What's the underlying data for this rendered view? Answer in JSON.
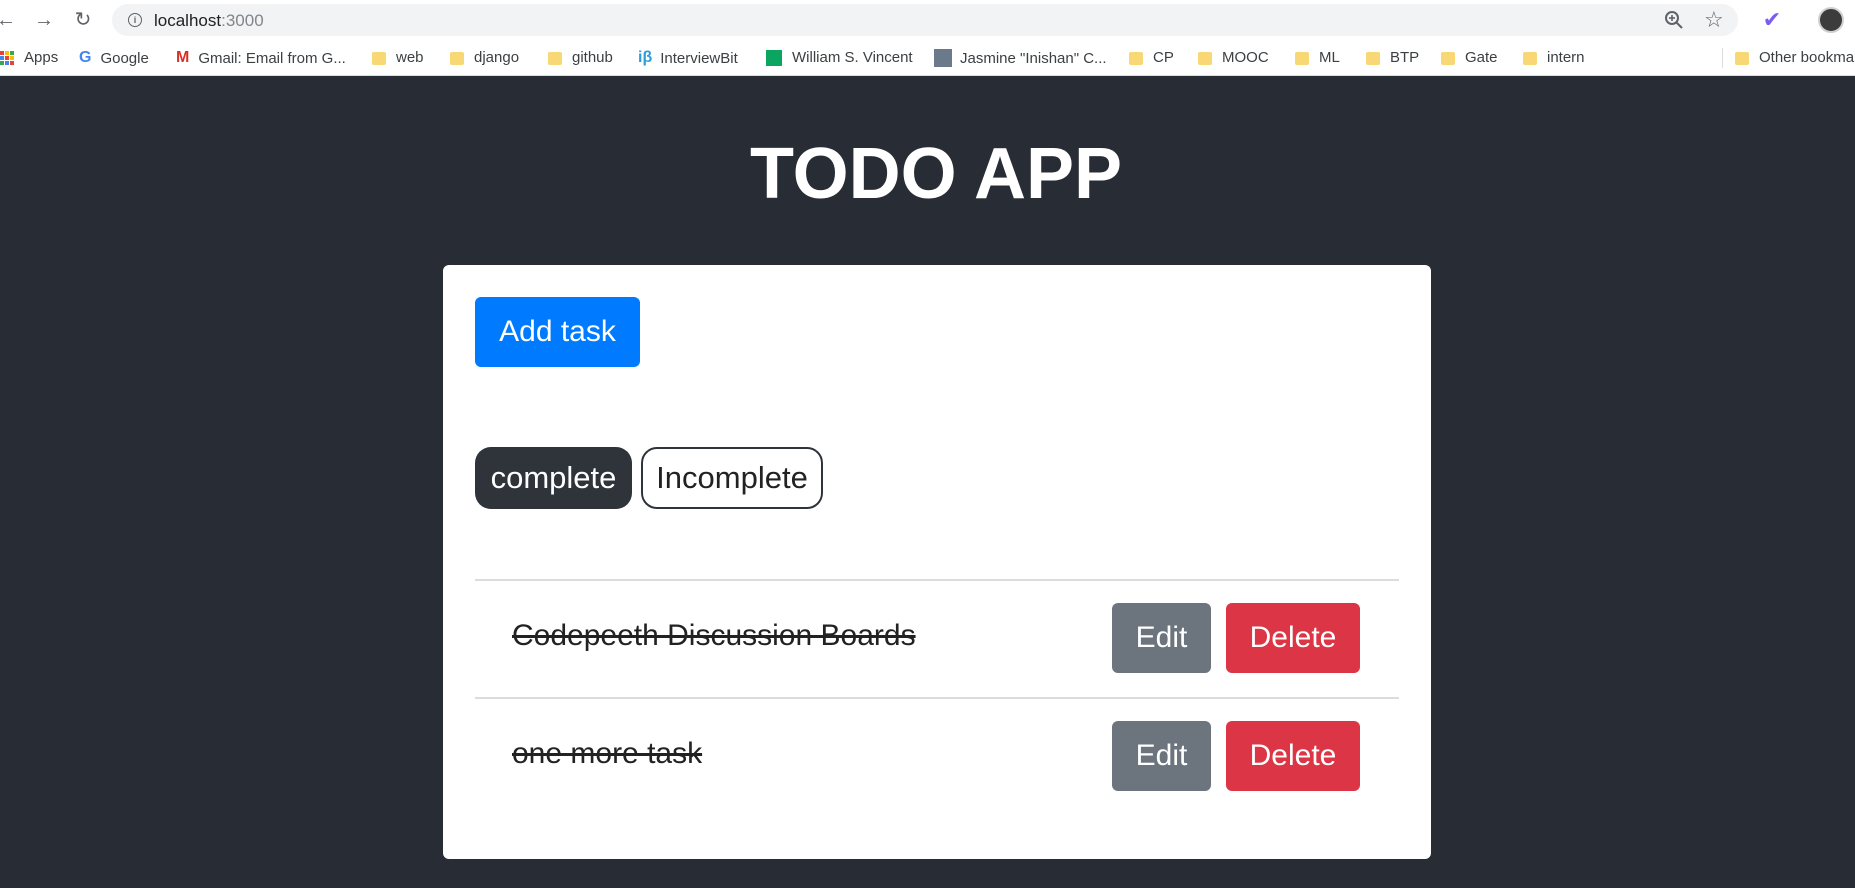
{
  "browser": {
    "url_host": "localhost",
    "url_port": ":3000",
    "bookmarks": [
      {
        "label": "Apps",
        "icon": "apps-grid-icon"
      },
      {
        "label": "Google",
        "icon": "google-icon"
      },
      {
        "label": "Gmail: Email from G...",
        "icon": "gmail-icon"
      },
      {
        "label": "web",
        "icon": "folder-icon"
      },
      {
        "label": "django",
        "icon": "folder-icon"
      },
      {
        "label": "github",
        "icon": "folder-icon"
      },
      {
        "label": "InterviewBit",
        "icon": "interviewbit-icon"
      },
      {
        "label": "William S. Vincent",
        "icon": "site-icon"
      },
      {
        "label": "Jasmine \"Inishan\" C...",
        "icon": "image-icon"
      },
      {
        "label": "CP",
        "icon": "folder-icon"
      },
      {
        "label": "MOOC",
        "icon": "folder-icon"
      },
      {
        "label": "ML",
        "icon": "folder-icon"
      },
      {
        "label": "BTP",
        "icon": "folder-icon"
      },
      {
        "label": "Gate",
        "icon": "folder-icon"
      },
      {
        "label": "intern",
        "icon": "folder-icon"
      },
      {
        "label": "Other bookmarks",
        "icon": "folder-icon"
      }
    ]
  },
  "app": {
    "title": "TODO APP",
    "add_task_label": "Add task",
    "filters": {
      "complete": "complete",
      "incomplete": "Incomplete",
      "active": "complete"
    },
    "todos": [
      {
        "text": "Codepeeth Discussion Boards",
        "completed": true,
        "edit_label": "Edit",
        "delete_label": "Delete"
      },
      {
        "text": "one more task",
        "completed": true,
        "edit_label": "Edit",
        "delete_label": "Delete"
      }
    ]
  },
  "colors": {
    "page_bg": "#282c34",
    "primary": "#007bff",
    "secondary": "#6c757d",
    "danger": "#dc3545",
    "dark": "#2f343b"
  }
}
